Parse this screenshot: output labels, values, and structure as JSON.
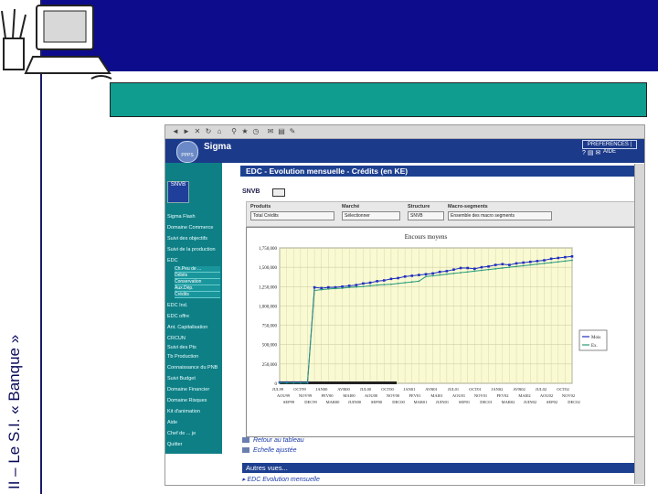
{
  "slide": {
    "title": "II – Le S.I. « Banque »"
  },
  "toolbar": {
    "icons": [
      "back-icon",
      "forward-icon",
      "stop-icon",
      "refresh-icon",
      "home-icon",
      "search-icon",
      "favorites-icon",
      "history-icon",
      "mail-icon",
      "print-icon",
      "edit-icon"
    ]
  },
  "app": {
    "name": "Sigma",
    "logo_text": "PPPS",
    "pref_label": "PREFERENCES | AIDE",
    "badge": "SNVB"
  },
  "sidebar": {
    "items": [
      "Sigma Flash",
      "Domaine Commerce",
      "Suivi des objectifs",
      "Suivi de la production",
      "EDC",
      "Dép.",
      "Crédits",
      "Conso",
      "EDC Ind.",
      "EDC offre",
      "Ant. Capitalisation",
      "CRCUN",
      "Suivi des Pts",
      "Tb Production",
      "Connaissance du PNB",
      "Suivi Budget",
      "Domaine Financier",
      "Domaine Risques",
      "Kit d'animation",
      "Aide",
      "Chef de ... je",
      "Quitter"
    ],
    "subitems": [
      "Ch.Peu de ...",
      "Débits",
      "Conservation",
      "Aux.Dép.",
      "Crédits"
    ]
  },
  "content": {
    "title": "EDC - Evolution mensuelle - Crédits (en KE)",
    "snvb": "SNVB",
    "filters": [
      {
        "label": "Produits",
        "value": "Total Crédits"
      },
      {
        "label": "Marché",
        "value": "Sélectionner"
      },
      {
        "label": "Structure",
        "value": "SNVB"
      },
      {
        "label": "Macro-segments",
        "value": "Ensemble des macro segments"
      }
    ],
    "link_retour": "Retour au tableau",
    "link_echelle": "Echelle ajustée",
    "autres_vues": "Autres vues...",
    "edc_link": "EDC Evolution mensuelle"
  },
  "colors": {
    "band": "#0c0c8c",
    "green_box": "#0f9d8f",
    "sidebar": "#0f7f86",
    "series_mois": "#1f2fbf",
    "series_ex": "#2a9a7a",
    "plot_bg": "#fafad2"
  },
  "chart_data": {
    "type": "line",
    "title": "Encours moyens",
    "xlabel": "",
    "ylabel": "",
    "ylim": [
      0,
      1750000
    ],
    "yticks": [
      "0",
      "250,000",
      "500,000",
      "750,000",
      "1,000,000",
      "1,250,000",
      "1,500,000",
      "1,750,000"
    ],
    "x_top": [
      "JUL99",
      "OCT99",
      "JAN00",
      "AVR00",
      "JUL00",
      "OCT00",
      "JAN01",
      "AVR01",
      "JUL01",
      "OCT01",
      "JAN02",
      "AVR02",
      "JUL02",
      "OCT02"
    ],
    "x_mid": [
      "AOU99",
      "NOV99",
      "FEV00",
      "MAI00",
      "AOU00",
      "NOV00",
      "FEV01",
      "MAI01",
      "AOU01",
      "NOV01",
      "FEV02",
      "MAI02",
      "AOU02",
      "NOV02"
    ],
    "x_bot": [
      "SEP99",
      "DEC99",
      "MAR00",
      "JUIN00",
      "SEP00",
      "DEC00",
      "MAR01",
      "JUIN01",
      "SEP01",
      "DEC01",
      "MAR02",
      "JUIN02",
      "SEP02",
      "DEC02"
    ],
    "grid": true,
    "legend": "right",
    "series": [
      {
        "name": "Mois",
        "values": [
          10000,
          10000,
          10000,
          10000,
          10000,
          1240000,
          1230000,
          1240000,
          1240000,
          1250000,
          1260000,
          1270000,
          1290000,
          1300000,
          1320000,
          1330000,
          1350000,
          1360000,
          1380000,
          1390000,
          1400000,
          1410000,
          1420000,
          1440000,
          1450000,
          1470000,
          1490000,
          1490000,
          1480000,
          1500000,
          1510000,
          1530000,
          1540000,
          1530000,
          1550000,
          1560000,
          1570000,
          1580000,
          1590000,
          1610000,
          1620000,
          1630000,
          1640000
        ]
      },
      {
        "name": "Ex.",
        "values": [
          5000,
          5000,
          5000,
          5000,
          5000,
          1200000,
          1210000,
          1220000,
          1225000,
          1230000,
          1240000,
          1245000,
          1250000,
          1260000,
          1270000,
          1275000,
          1280000,
          1290000,
          1300000,
          1310000,
          1320000,
          1380000,
          1390000,
          1400000,
          1410000,
          1420000,
          1430000,
          1440000,
          1450000,
          1460000,
          1470000,
          1480000,
          1490000,
          1500000,
          1510000,
          1520000,
          1530000,
          1540000,
          1550000,
          1560000,
          1570000,
          1580000,
          1590000
        ]
      }
    ]
  }
}
